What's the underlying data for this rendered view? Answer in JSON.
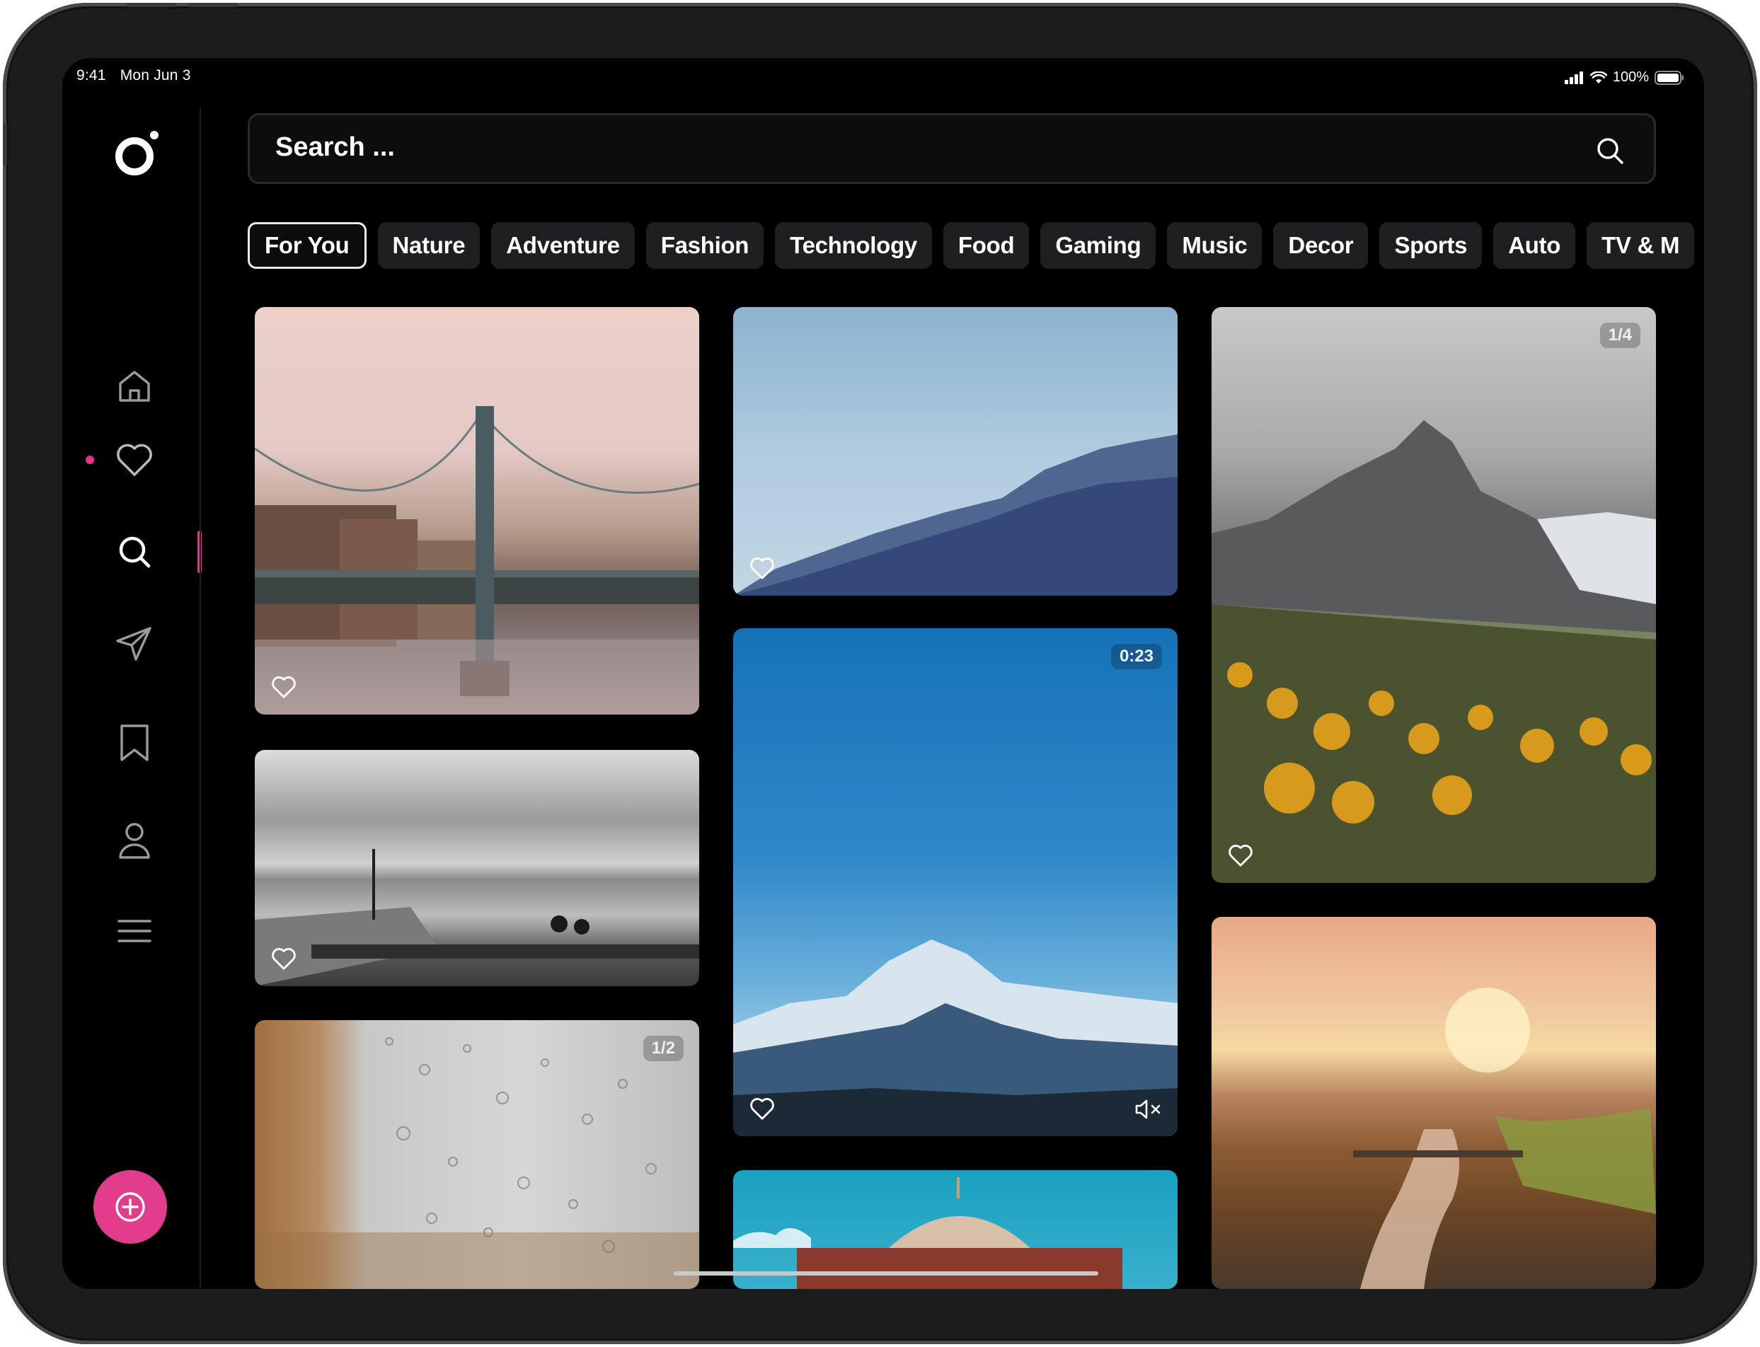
{
  "status_bar": {
    "time": "9:41",
    "date": "Mon Jun 3",
    "battery": "100%"
  },
  "sidebar": {
    "logo_icon": "circle-logo-icon",
    "items": [
      {
        "name": "home",
        "icon": "home-icon"
      },
      {
        "name": "favorites",
        "icon": "heart-icon",
        "has_notification": true
      },
      {
        "name": "search",
        "icon": "search-icon",
        "active": true
      },
      {
        "name": "messages",
        "icon": "send-icon"
      },
      {
        "name": "saved",
        "icon": "bookmark-icon"
      },
      {
        "name": "profile",
        "icon": "user-icon"
      },
      {
        "name": "menu",
        "icon": "menu-icon"
      }
    ],
    "fab_icon": "plus-circle-icon",
    "accent_color": "#e23d8c"
  },
  "search": {
    "placeholder": "Search ..."
  },
  "categories": [
    {
      "label": "For You",
      "active": true
    },
    {
      "label": "Nature"
    },
    {
      "label": "Adventure"
    },
    {
      "label": "Fashion"
    },
    {
      "label": "Technology"
    },
    {
      "label": "Food"
    },
    {
      "label": "Gaming"
    },
    {
      "label": "Music"
    },
    {
      "label": "Decor"
    },
    {
      "label": "Sports"
    },
    {
      "label": "Auto"
    },
    {
      "label": "TV & M"
    }
  ],
  "feed": {
    "col1": [
      {
        "name": "bridge-photo"
      },
      {
        "name": "pier-photo"
      },
      {
        "name": "raindrops-photo",
        "badge": "1/2"
      }
    ],
    "col2": [
      {
        "name": "mountain-silhouette-photo"
      },
      {
        "name": "snowy-mountain-video",
        "badge": "0:23",
        "muted": true
      },
      {
        "name": "dome-photo"
      }
    ],
    "col3": [
      {
        "name": "alpine-peak-photo",
        "badge": "1/4"
      },
      {
        "name": "sunset-river-photo"
      }
    ]
  }
}
